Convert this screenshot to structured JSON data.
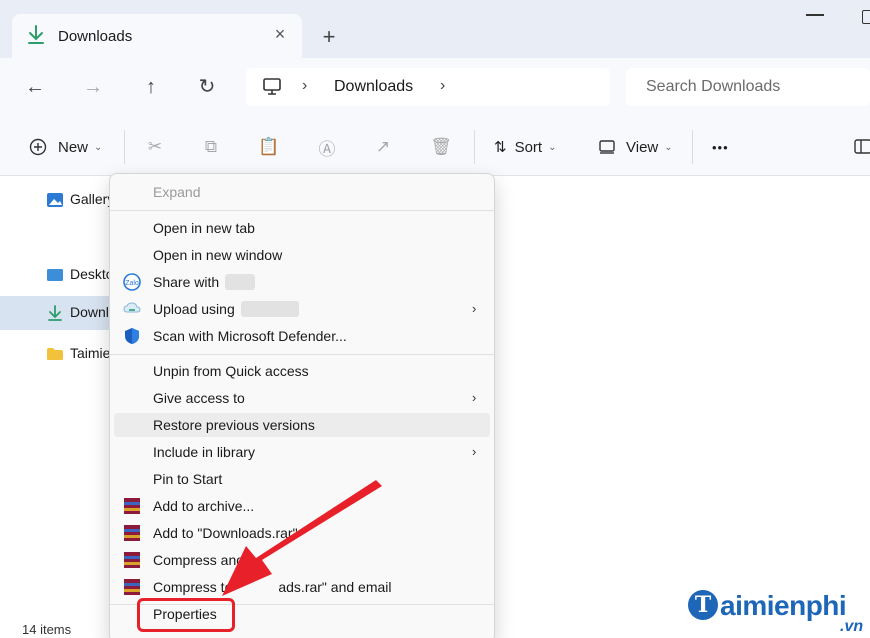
{
  "tab": {
    "title": "Downloads",
    "close": "×",
    "new_tab": "+"
  },
  "nav": {
    "back": "←",
    "forward": "→",
    "up": "↑",
    "refresh": "↻"
  },
  "address": {
    "chevron": "›",
    "location": "Downloads"
  },
  "search": {
    "placeholder": "Search Downloads"
  },
  "toolbar": {
    "new_label": "New",
    "sort_label": "Sort",
    "view_label": "View",
    "more": "•••",
    "caret": "⌄"
  },
  "sidebar": {
    "items": [
      {
        "label": "Gallery"
      },
      {
        "label": "Desktop"
      },
      {
        "label": "Downloads"
      },
      {
        "label": "Taimienphi"
      }
    ]
  },
  "status": {
    "item_count": "14 items"
  },
  "context_menu": {
    "items": [
      {
        "label": "Expand",
        "disabled": true
      },
      {
        "label": "Open in new tab"
      },
      {
        "label": "Open in new window"
      },
      {
        "label": "Share with"
      },
      {
        "label": "Upload using",
        "submenu": true
      },
      {
        "label": "Scan with Microsoft Defender..."
      },
      {
        "label": "Unpin from Quick access"
      },
      {
        "label": "Give access to",
        "submenu": true
      },
      {
        "label": "Restore previous versions"
      },
      {
        "label": "Include in library",
        "submenu": true
      },
      {
        "label": "Pin to Start"
      },
      {
        "label": "Add to archive..."
      },
      {
        "label": "Add to \"Downloads.rar\""
      },
      {
        "label": "Compress and"
      },
      {
        "label": "Compress to",
        "label_tail": "ads.rar\" and email"
      },
      {
        "label": "Properties"
      }
    ],
    "submenu_arrow": "›"
  },
  "watermark": {
    "initial": "T",
    "text": "aimienphi",
    "suffix": ".vn"
  },
  "colors": {
    "accent": "#1d66b8",
    "annotation_red": "#e8202a",
    "selected_bg": "#d7e3f0",
    "download_green": "#2e9c6a"
  },
  "icons": {
    "tab": "download-arrow-icon",
    "share": "share-icon",
    "upload": "cloud-upload-icon",
    "defender": "defender-shield-icon",
    "archive": "winrar-icon"
  }
}
